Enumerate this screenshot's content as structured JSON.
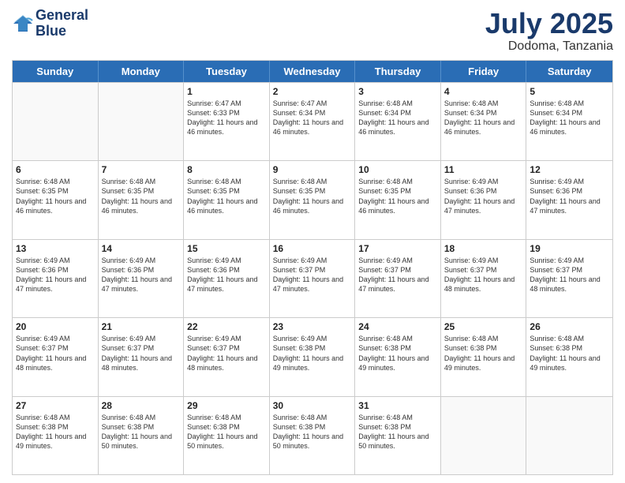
{
  "header": {
    "logo_line1": "General",
    "logo_line2": "Blue",
    "month": "July 2025",
    "location": "Dodoma, Tanzania"
  },
  "days_of_week": [
    "Sunday",
    "Monday",
    "Tuesday",
    "Wednesday",
    "Thursday",
    "Friday",
    "Saturday"
  ],
  "weeks": [
    [
      {
        "day": "",
        "sunrise": "",
        "sunset": "",
        "daylight": ""
      },
      {
        "day": "",
        "sunrise": "",
        "sunset": "",
        "daylight": ""
      },
      {
        "day": "1",
        "sunrise": "Sunrise: 6:47 AM",
        "sunset": "Sunset: 6:33 PM",
        "daylight": "Daylight: 11 hours and 46 minutes."
      },
      {
        "day": "2",
        "sunrise": "Sunrise: 6:47 AM",
        "sunset": "Sunset: 6:34 PM",
        "daylight": "Daylight: 11 hours and 46 minutes."
      },
      {
        "day": "3",
        "sunrise": "Sunrise: 6:48 AM",
        "sunset": "Sunset: 6:34 PM",
        "daylight": "Daylight: 11 hours and 46 minutes."
      },
      {
        "day": "4",
        "sunrise": "Sunrise: 6:48 AM",
        "sunset": "Sunset: 6:34 PM",
        "daylight": "Daylight: 11 hours and 46 minutes."
      },
      {
        "day": "5",
        "sunrise": "Sunrise: 6:48 AM",
        "sunset": "Sunset: 6:34 PM",
        "daylight": "Daylight: 11 hours and 46 minutes."
      }
    ],
    [
      {
        "day": "6",
        "sunrise": "Sunrise: 6:48 AM",
        "sunset": "Sunset: 6:35 PM",
        "daylight": "Daylight: 11 hours and 46 minutes."
      },
      {
        "day": "7",
        "sunrise": "Sunrise: 6:48 AM",
        "sunset": "Sunset: 6:35 PM",
        "daylight": "Daylight: 11 hours and 46 minutes."
      },
      {
        "day": "8",
        "sunrise": "Sunrise: 6:48 AM",
        "sunset": "Sunset: 6:35 PM",
        "daylight": "Daylight: 11 hours and 46 minutes."
      },
      {
        "day": "9",
        "sunrise": "Sunrise: 6:48 AM",
        "sunset": "Sunset: 6:35 PM",
        "daylight": "Daylight: 11 hours and 46 minutes."
      },
      {
        "day": "10",
        "sunrise": "Sunrise: 6:48 AM",
        "sunset": "Sunset: 6:35 PM",
        "daylight": "Daylight: 11 hours and 46 minutes."
      },
      {
        "day": "11",
        "sunrise": "Sunrise: 6:49 AM",
        "sunset": "Sunset: 6:36 PM",
        "daylight": "Daylight: 11 hours and 47 minutes."
      },
      {
        "day": "12",
        "sunrise": "Sunrise: 6:49 AM",
        "sunset": "Sunset: 6:36 PM",
        "daylight": "Daylight: 11 hours and 47 minutes."
      }
    ],
    [
      {
        "day": "13",
        "sunrise": "Sunrise: 6:49 AM",
        "sunset": "Sunset: 6:36 PM",
        "daylight": "Daylight: 11 hours and 47 minutes."
      },
      {
        "day": "14",
        "sunrise": "Sunrise: 6:49 AM",
        "sunset": "Sunset: 6:36 PM",
        "daylight": "Daylight: 11 hours and 47 minutes."
      },
      {
        "day": "15",
        "sunrise": "Sunrise: 6:49 AM",
        "sunset": "Sunset: 6:36 PM",
        "daylight": "Daylight: 11 hours and 47 minutes."
      },
      {
        "day": "16",
        "sunrise": "Sunrise: 6:49 AM",
        "sunset": "Sunset: 6:37 PM",
        "daylight": "Daylight: 11 hours and 47 minutes."
      },
      {
        "day": "17",
        "sunrise": "Sunrise: 6:49 AM",
        "sunset": "Sunset: 6:37 PM",
        "daylight": "Daylight: 11 hours and 47 minutes."
      },
      {
        "day": "18",
        "sunrise": "Sunrise: 6:49 AM",
        "sunset": "Sunset: 6:37 PM",
        "daylight": "Daylight: 11 hours and 48 minutes."
      },
      {
        "day": "19",
        "sunrise": "Sunrise: 6:49 AM",
        "sunset": "Sunset: 6:37 PM",
        "daylight": "Daylight: 11 hours and 48 minutes."
      }
    ],
    [
      {
        "day": "20",
        "sunrise": "Sunrise: 6:49 AM",
        "sunset": "Sunset: 6:37 PM",
        "daylight": "Daylight: 11 hours and 48 minutes."
      },
      {
        "day": "21",
        "sunrise": "Sunrise: 6:49 AM",
        "sunset": "Sunset: 6:37 PM",
        "daylight": "Daylight: 11 hours and 48 minutes."
      },
      {
        "day": "22",
        "sunrise": "Sunrise: 6:49 AM",
        "sunset": "Sunset: 6:37 PM",
        "daylight": "Daylight: 11 hours and 48 minutes."
      },
      {
        "day": "23",
        "sunrise": "Sunrise: 6:49 AM",
        "sunset": "Sunset: 6:38 PM",
        "daylight": "Daylight: 11 hours and 49 minutes."
      },
      {
        "day": "24",
        "sunrise": "Sunrise: 6:48 AM",
        "sunset": "Sunset: 6:38 PM",
        "daylight": "Daylight: 11 hours and 49 minutes."
      },
      {
        "day": "25",
        "sunrise": "Sunrise: 6:48 AM",
        "sunset": "Sunset: 6:38 PM",
        "daylight": "Daylight: 11 hours and 49 minutes."
      },
      {
        "day": "26",
        "sunrise": "Sunrise: 6:48 AM",
        "sunset": "Sunset: 6:38 PM",
        "daylight": "Daylight: 11 hours and 49 minutes."
      }
    ],
    [
      {
        "day": "27",
        "sunrise": "Sunrise: 6:48 AM",
        "sunset": "Sunset: 6:38 PM",
        "daylight": "Daylight: 11 hours and 49 minutes."
      },
      {
        "day": "28",
        "sunrise": "Sunrise: 6:48 AM",
        "sunset": "Sunset: 6:38 PM",
        "daylight": "Daylight: 11 hours and 50 minutes."
      },
      {
        "day": "29",
        "sunrise": "Sunrise: 6:48 AM",
        "sunset": "Sunset: 6:38 PM",
        "daylight": "Daylight: 11 hours and 50 minutes."
      },
      {
        "day": "30",
        "sunrise": "Sunrise: 6:48 AM",
        "sunset": "Sunset: 6:38 PM",
        "daylight": "Daylight: 11 hours and 50 minutes."
      },
      {
        "day": "31",
        "sunrise": "Sunrise: 6:48 AM",
        "sunset": "Sunset: 6:38 PM",
        "daylight": "Daylight: 11 hours and 50 minutes."
      },
      {
        "day": "",
        "sunrise": "",
        "sunset": "",
        "daylight": ""
      },
      {
        "day": "",
        "sunrise": "",
        "sunset": "",
        "daylight": ""
      }
    ]
  ]
}
